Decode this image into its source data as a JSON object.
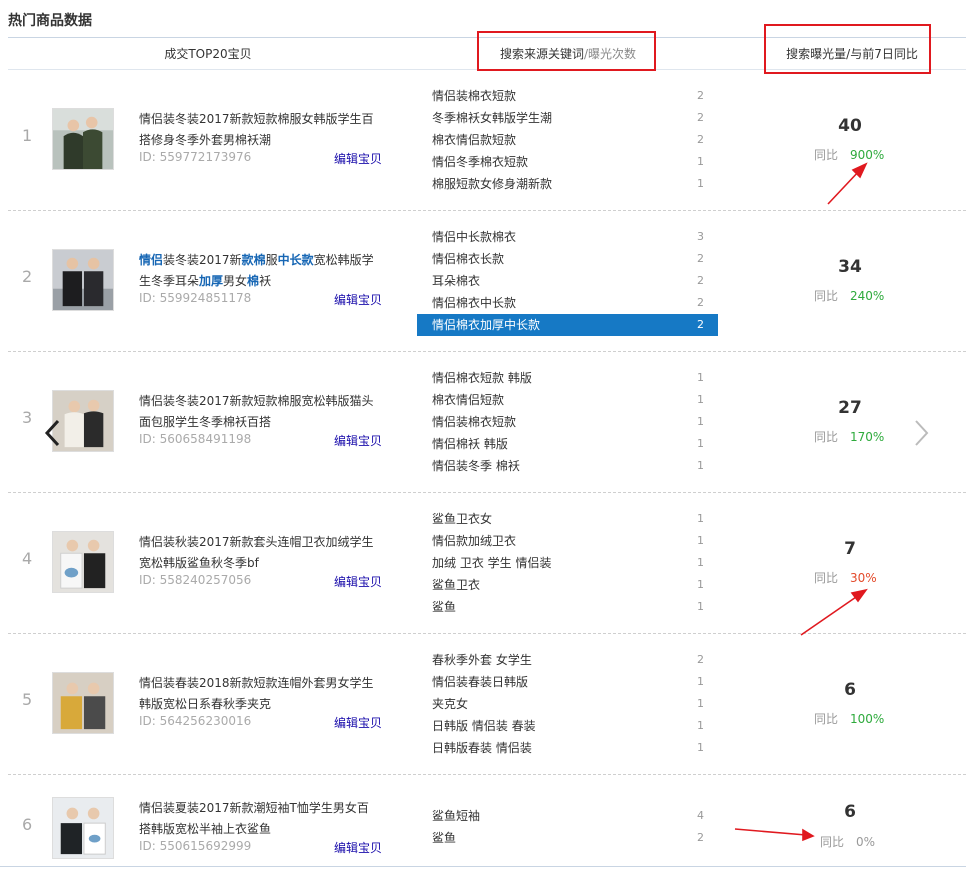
{
  "section_title": "热门商品数据",
  "headers": {
    "product": "成交TOP20宝贝",
    "keywords_main": "搜索来源关键词",
    "keywords_sep": "/",
    "keywords_muted": "曝光次数",
    "exposure": "搜索曝光量/与前7日同比"
  },
  "yoy_label": "同比",
  "edit_label": "编辑宝贝",
  "rows": [
    {
      "rank": "1",
      "title": "情侣装冬装2017新款短款棉服女韩版学生百搭修身冬季外套男棉袄潮",
      "id": "ID: 559772173976",
      "keywords": [
        {
          "text": "情侣装棉衣短款",
          "count": "2"
        },
        {
          "text": "冬季棉袄女韩版学生潮",
          "count": "2"
        },
        {
          "text": "棉衣情侣款短款",
          "count": "2"
        },
        {
          "text": "情侣冬季棉衣短款",
          "count": "1"
        },
        {
          "text": "棉服短款女修身潮新款",
          "count": "1"
        }
      ],
      "exposure": "40",
      "yoy": "900%",
      "yoy_color": "#2eaa3c"
    },
    {
      "rank": "2",
      "title_parts": [
        "情侣",
        "装冬装2017新",
        "款",
        "棉",
        "服",
        "中长款",
        "宽松韩版学生冬季耳朵",
        "加厚",
        "男女",
        "棉",
        "袄"
      ],
      "id": "ID: 559924851178",
      "keywords": [
        {
          "text": "情侣中长款棉衣",
          "count": "3"
        },
        {
          "text": "情侣棉衣长款",
          "count": "2"
        },
        {
          "text": "耳朵棉衣",
          "count": "2"
        },
        {
          "text": "情侣棉衣中长款",
          "count": "2"
        },
        {
          "text": "情侣棉衣加厚中长款",
          "count": "2"
        }
      ],
      "exposure": "34",
      "yoy": "240%",
      "yoy_color": "#2eaa3c"
    },
    {
      "rank": "3",
      "title": "情侣装冬装2017新款短款棉服宽松韩版猫头面包服学生冬季棉袄百搭",
      "id": "ID: 560658491198",
      "keywords": [
        {
          "text": "情侣棉衣短款 韩版",
          "count": "1"
        },
        {
          "text": "棉衣情侣短款",
          "count": "1"
        },
        {
          "text": "情侣装棉衣短款",
          "count": "1"
        },
        {
          "text": "情侣棉袄 韩版",
          "count": "1"
        },
        {
          "text": "情侣装冬季 棉袄",
          "count": "1"
        }
      ],
      "exposure": "27",
      "yoy": "170%",
      "yoy_color": "#2eaa3c"
    },
    {
      "rank": "4",
      "title": "情侣装秋装2017新款套头连帽卫衣加绒学生宽松韩版鲨鱼秋冬季bf",
      "id": "ID: 558240257056",
      "keywords": [
        {
          "text": "鲨鱼卫衣女",
          "count": "1"
        },
        {
          "text": "情侣款加绒卫衣",
          "count": "1"
        },
        {
          "text": "加绒 卫衣 学生 情侣装",
          "count": "1"
        },
        {
          "text": "鲨鱼卫衣",
          "count": "1"
        },
        {
          "text": "鲨鱼",
          "count": "1"
        }
      ],
      "exposure": "7",
      "yoy": "30%",
      "yoy_color": "#e34a2b"
    },
    {
      "rank": "5",
      "title": "情侣装春装2018新款短款连帽外套男女学生韩版宽松日系春秋季夹克",
      "id": "ID: 564256230016",
      "keywords": [
        {
          "text": "春秋季外套 女学生",
          "count": "2"
        },
        {
          "text": "情侣装春装日韩版",
          "count": "1"
        },
        {
          "text": "夹克女",
          "count": "1"
        },
        {
          "text": "日韩版 情侣装 春装",
          "count": "1"
        },
        {
          "text": "日韩版春装 情侣装",
          "count": "1"
        }
      ],
      "exposure": "6",
      "yoy": "100%",
      "yoy_color": "#2eaa3c"
    },
    {
      "rank": "6",
      "title": "情侣装夏装2017新款潮短袖T恤学生男女百搭韩版宽松半袖上衣鲨鱼",
      "id": "ID: 550615692999",
      "keywords": [
        {
          "text": "鲨鱼短袖",
          "count": "4"
        },
        {
          "text": "鲨鱼",
          "count": "2"
        }
      ],
      "exposure": "6",
      "yoy": "0%",
      "yoy_color": "#999999"
    }
  ],
  "colors": {
    "highlight_blue": "#1679c5",
    "link_blue": "#1a0dab",
    "annotation_red": "#e0191f"
  },
  "icons": {
    "prev": "chevron-left-icon",
    "next": "chevron-right-icon"
  }
}
